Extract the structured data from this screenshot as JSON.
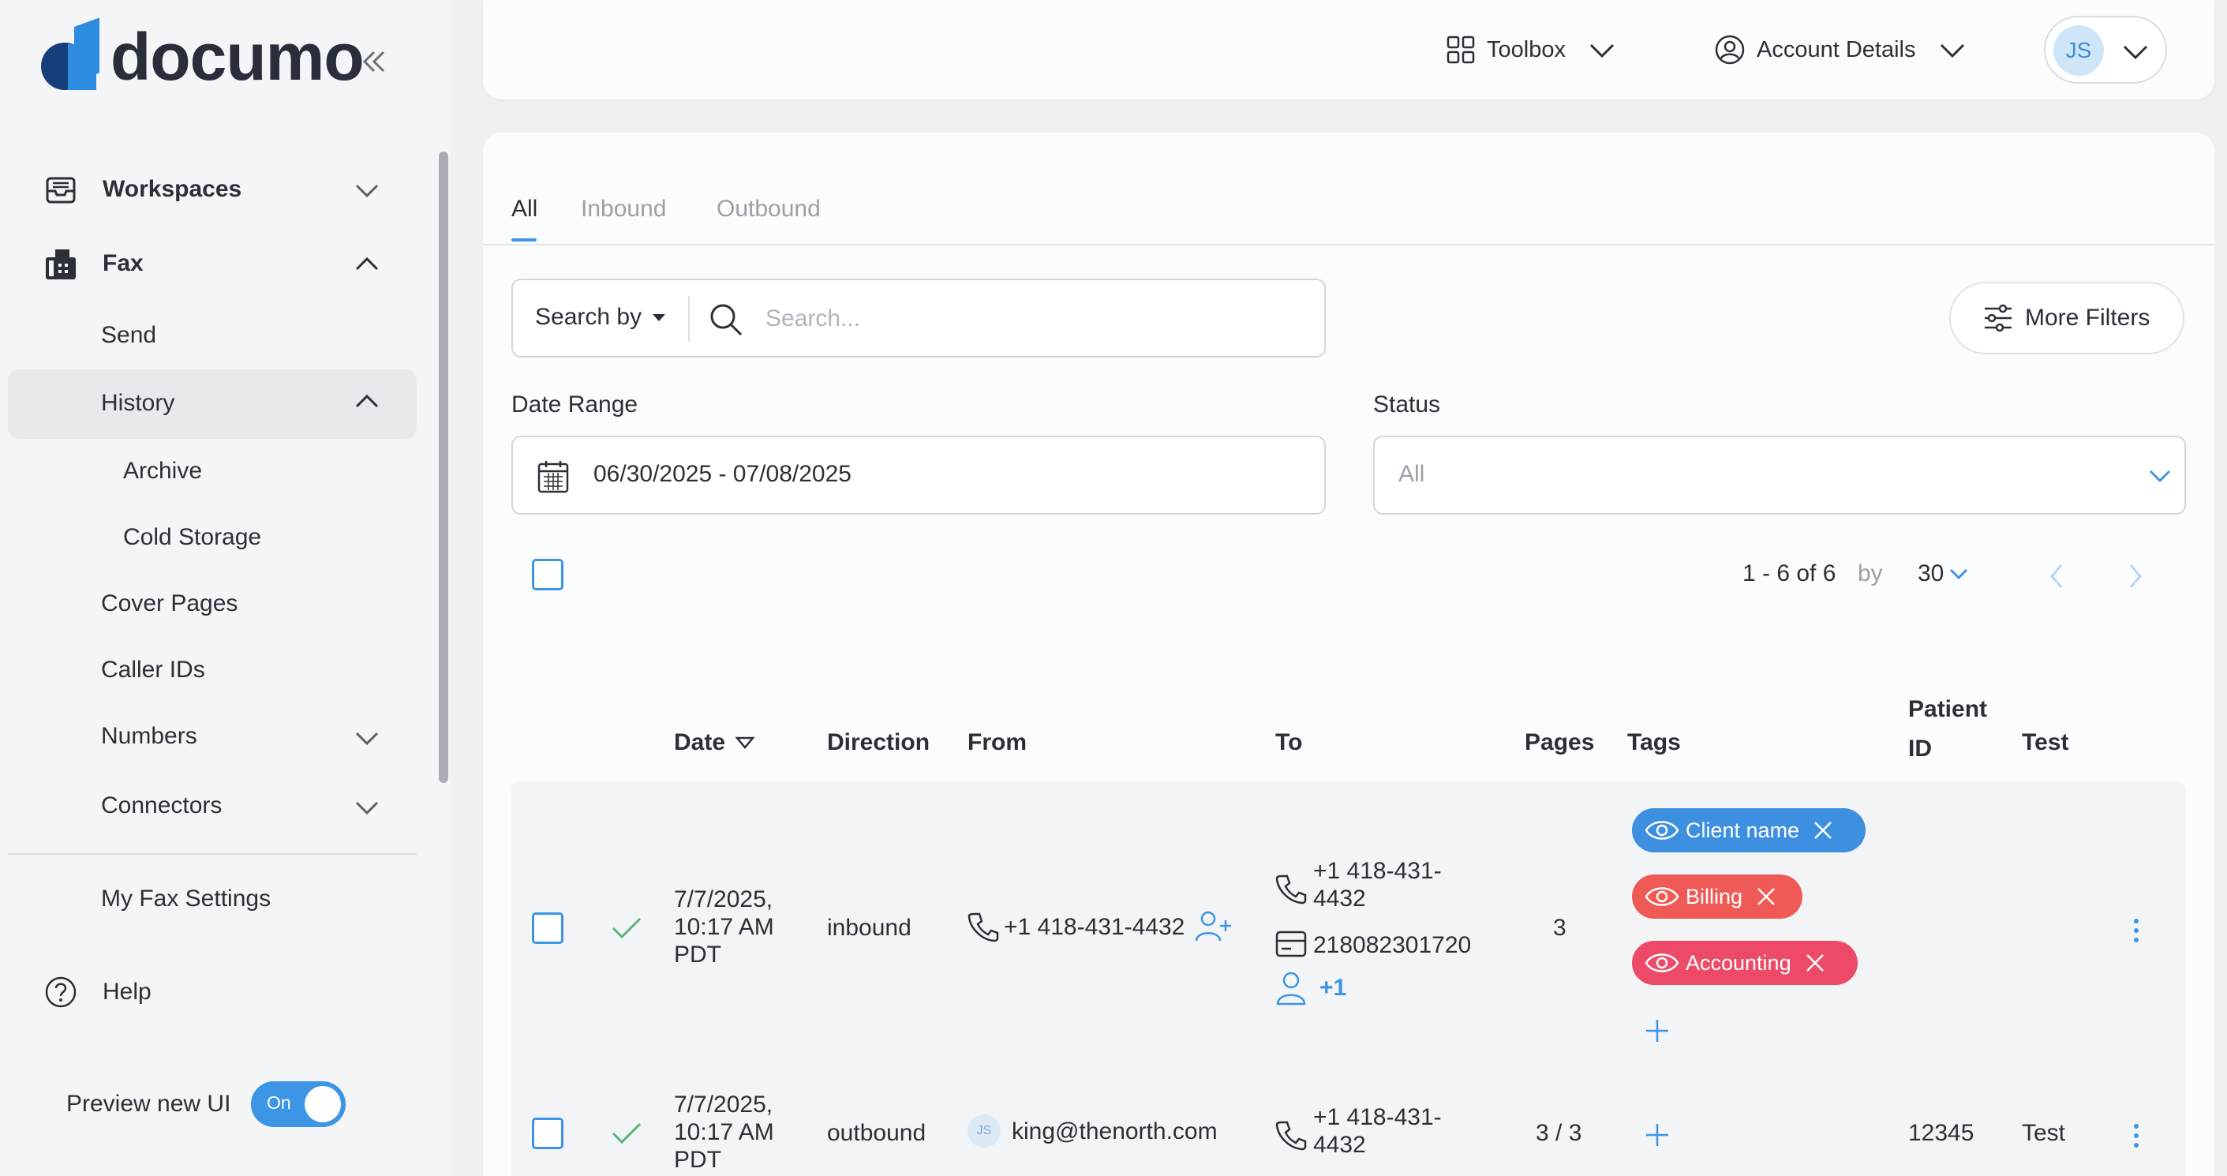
{
  "brand": {
    "name": "documo"
  },
  "sidebar": {
    "workspaces": "Workspaces",
    "fax": "Fax",
    "send": "Send",
    "history": "History",
    "archive": "Archive",
    "cold_storage": "Cold Storage",
    "cover_pages": "Cover Pages",
    "caller_ids": "Caller IDs",
    "numbers": "Numbers",
    "connectors": "Connectors",
    "my_fax_settings": "My Fax Settings",
    "help": "Help",
    "preview_label": "Preview new UI",
    "preview_toggle": "On"
  },
  "header": {
    "toolbox": "Toolbox",
    "account_details": "Account Details",
    "avatar_initials": "JS"
  },
  "tabs": {
    "all": "All",
    "inbound": "Inbound",
    "outbound": "Outbound"
  },
  "search": {
    "search_by": "Search by",
    "placeholder": "Search...",
    "more_filters": "More Filters"
  },
  "filters": {
    "date_range_label": "Date Range",
    "date_range_value": "06/30/2025 - 07/08/2025",
    "status_label": "Status",
    "status_value": "All"
  },
  "pagination": {
    "range": "1 - 6 of 6",
    "by": "by",
    "per_page": "30"
  },
  "table": {
    "headers": {
      "date": "Date",
      "direction": "Direction",
      "from": "From",
      "to": "To",
      "pages": "Pages",
      "tags": "Tags",
      "patient_id_1": "Patient",
      "patient_id_2": "ID",
      "test": "Test"
    },
    "rows": [
      {
        "date_1": "7/7/2025,",
        "date_2": "10:17 AM",
        "date_3": "PDT",
        "direction": "inbound",
        "from": "+1 418-431-4432",
        "to_phone_1": "+1 418-431-",
        "to_phone_2": "4432",
        "to_fax": "218082301720",
        "to_more": "+1",
        "pages": "3",
        "tags": [
          "Client name",
          "Billing",
          "Accounting"
        ],
        "patient_id": "",
        "test": ""
      },
      {
        "date_1": "7/7/2025,",
        "date_2": "10:17 AM",
        "date_3": "PDT",
        "direction": "outbound",
        "from_avatar": "JS",
        "from": "king@thenorth.com",
        "to_phone_1": "+1 418-431-",
        "to_phone_2": "4432",
        "pages": "3 / 3",
        "patient_id": "12345",
        "test": "Test"
      }
    ]
  },
  "colors": {
    "accent": "#3d95e6",
    "tag_client": "#3d8fe0",
    "tag_billing": "#ef5a56",
    "tag_accounting": "#ec4a66",
    "check_green": "#5cb27a"
  }
}
